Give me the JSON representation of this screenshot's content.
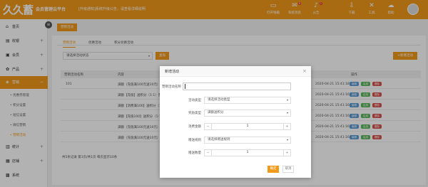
{
  "header": {
    "logo": "久久蓄",
    "brand": "会员管理云平台",
    "notice": "[升级通知]系统升级公告，请查看详细说明",
    "tools": [
      {
        "label": "打开钱箱",
        "icon": "cash-drawer-icon",
        "glyph": "▭"
      },
      {
        "label": "系统消息",
        "icon": "message-icon",
        "glyph": "✉",
        "badge": "8"
      },
      {
        "label": "公告",
        "icon": "bell-icon",
        "glyph": "♪",
        "badge": "2"
      },
      {
        "label": "下载",
        "icon": "download-icon",
        "glyph": "⇩"
      },
      {
        "label": "工具",
        "icon": "tools-icon",
        "glyph": "✕"
      },
      {
        "label": "帮助",
        "icon": "help-icon",
        "glyph": "☁"
      }
    ]
  },
  "sidebar": {
    "items": [
      {
        "label": "首页",
        "icon": "home-icon",
        "glyph": "⌂"
      },
      {
        "label": "收银",
        "icon": "cashier-icon",
        "glyph": "▤",
        "plus": "+"
      },
      {
        "label": "会员",
        "icon": "member-icon",
        "glyph": "▣",
        "plus": "+"
      },
      {
        "label": "产品",
        "icon": "product-icon",
        "glyph": "✿",
        "plus": "+"
      },
      {
        "label": "营销",
        "icon": "marketing-icon",
        "glyph": "◈",
        "plus": "−"
      }
    ],
    "subitems": [
      "优惠券管理",
      "积分设置",
      "短信设置",
      "微信营销",
      "营销活动"
    ],
    "items2": [
      {
        "label": "统计",
        "icon": "stats-icon",
        "glyph": "▥",
        "plus": "+"
      },
      {
        "label": "店铺",
        "icon": "shop-icon",
        "glyph": "▦",
        "plus": "+"
      },
      {
        "label": "系统",
        "icon": "system-icon",
        "glyph": "▩"
      }
    ]
  },
  "breadcrumb_tab": "营销活动",
  "tabs": [
    "营销活动",
    "优惠活动",
    "积分兑换活动"
  ],
  "toolbar": {
    "filter_value": "请选择活动状态",
    "query_label": "查询",
    "add_label": "+新增活动"
  },
  "table": {
    "headers": [
      "营销活动名称",
      "内容",
      "操作"
    ],
    "rows": [
      {
        "name": "101",
        "content": "满额（充值满100元送10元）送积分（1:1）",
        "date": "2020-04-21 15:41:18"
      },
      {
        "name": "",
        "content": "满额【充值】送积分（1:1）营销活动说明",
        "date": "2020-04-21 15:41:16"
      },
      {
        "name": "",
        "content": "满额【消费满100】送积分（1:1）说明",
        "date": "2020-04-21 15:41:16"
      },
      {
        "name": "",
        "content": "满额【充值100】送积分（1:1）说明",
        "date": "2020-04-21 15:41:16"
      },
      {
        "name": "",
        "content": "满额（充值满100元送10元）送积分",
        "date": "2020-04-21 15:41:16"
      },
      {
        "name": "",
        "content": "满额（充值满100元送10元）送积分",
        "date": "2020-04-21 15:41:16"
      }
    ],
    "actions": [
      "编辑",
      "启用",
      "删除"
    ],
    "footer": "共5条记录  第1页/共1页  每页显示10条"
  },
  "modal": {
    "title": "新增活动",
    "fields": {
      "name_label": "营销活动名称",
      "activity_type_label": "活动类型",
      "activity_type_value": "请选择活动类型",
      "reward_type_label": "奖励类型",
      "reward_type_value": "满额送积分",
      "rule_amount_label": "消费金额",
      "rule_amount_value": "1",
      "gift_rule_label": "赠送规则",
      "gift_rule_value": "请选择赠送规则",
      "gift_amount_label": "赠送数量",
      "gift_amount_value": "1"
    },
    "ok_label": "确定",
    "cancel_label": "取消"
  },
  "colors": {
    "accent": "#f19a1a",
    "edit": "#5b9bd5",
    "enable": "#5cb85c",
    "delete": "#d9534f"
  }
}
